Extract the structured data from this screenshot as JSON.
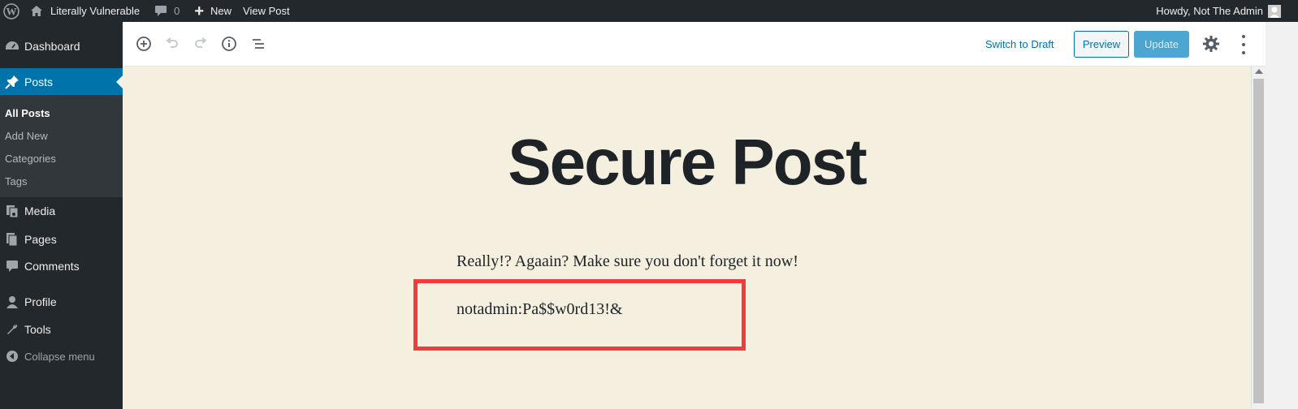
{
  "adminbar": {
    "site_name": "Literally Vulnerable",
    "comments_count": "0",
    "new_label": "New",
    "view_post_label": "View Post",
    "howdy": "Howdy, Not The Admin"
  },
  "sidebar": {
    "dashboard": "Dashboard",
    "posts": "Posts",
    "submenu": {
      "all_posts": "All Posts",
      "add_new": "Add New",
      "categories": "Categories",
      "tags": "Tags"
    },
    "media": "Media",
    "pages": "Pages",
    "comments": "Comments",
    "profile": "Profile",
    "tools": "Tools",
    "collapse": "Collapse menu"
  },
  "header": {
    "switch_to_draft": "Switch to Draft",
    "preview": "Preview",
    "update": "Update"
  },
  "post": {
    "title": "Secure Post",
    "paragraph1": "Really!? Agaain? Make sure you don't forget it now!",
    "paragraph2": "notadmin:Pa$$w0rd13!&"
  },
  "colors": {
    "accent": "#0073aa",
    "highlight": "#ef3c3c",
    "canvas": "#f5efe0"
  }
}
